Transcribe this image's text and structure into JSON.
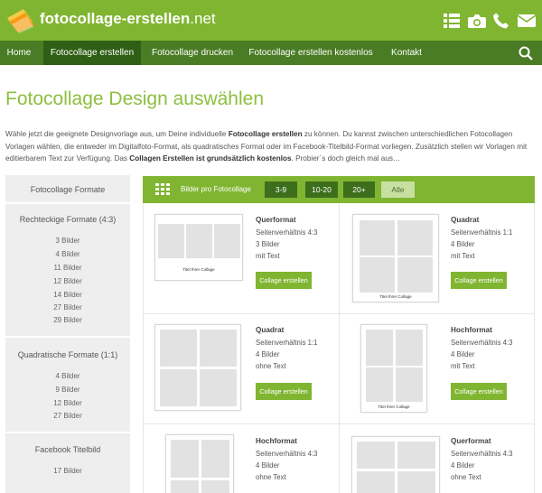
{
  "header": {
    "logo_text_main": "fotocollage-erstellen",
    "logo_text_suffix": ".net",
    "icons": [
      "grid-icon",
      "camera-icon",
      "phone-icon",
      "mail-icon"
    ]
  },
  "nav": {
    "items": [
      {
        "label": "Home",
        "active": false
      },
      {
        "label": "Fotocollage erstellen",
        "active": true
      },
      {
        "label": "Fotocollage drucken",
        "active": false
      },
      {
        "label": "Fotocollage erstellen kostenlos",
        "active": false
      },
      {
        "label": "Kontakt",
        "active": false
      }
    ],
    "search_icon": "search-icon"
  },
  "page": {
    "title": "Fotocollage Design auswählen",
    "intro_1": "Wähle jetzt die geeignete Designvorlage aus, um Deine individuelle ",
    "intro_b1": "Fotocollage erstellen",
    "intro_2": " zu können. Du kannst zwischen unterschiedlichen Fotocollagen Vorlagen wählen, die entweder im Digitalfoto-Format, als quadratisches Format oder im Facebook-Titelbild-Format vorliegen. Zusätzlich stellen wir Vorlagen mit editierbarem Text zur Verfügung. Das ",
    "intro_b2": "Collagen Erstellen ist grundsätzlich kostenlos",
    "intro_3": ". Probier´s doch gleich mal aus…"
  },
  "sidebar": {
    "heading": "Fotocollage Formate",
    "groups": [
      {
        "label": "Rechteckige Formate (4:3)",
        "items": [
          "3 Bilder",
          "4 Bilder",
          "11 Bilder",
          "12 Bilder",
          "14 Bilder",
          "27 Bilder",
          "29 Bilder"
        ]
      },
      {
        "label": "Quadratische Formate (1:1)",
        "items": [
          "4 Bilder",
          "9 Bilder",
          "12 Bilder",
          "27 Bilder"
        ]
      },
      {
        "label": "Facebook Titelbild",
        "items": [
          "17 Bilder"
        ]
      }
    ]
  },
  "filter": {
    "label": "Bilder pro Fotocollage",
    "buttons": [
      "3-9",
      "10-20",
      "20+",
      "Alle"
    ],
    "selected": "Alle"
  },
  "cards": [
    {
      "title": "Querformat",
      "ratio": "Seitenverhältnis 4:3",
      "count": "3 Bilder",
      "text": "mit Text",
      "button": "Collage erstellen",
      "caption": "Titel Ihrer Collage"
    },
    {
      "title": "Quadrat",
      "ratio": "Seitenverhältnis 1:1",
      "count": "4 Bilder",
      "text": "mit Text",
      "button": "Collage erstellen",
      "caption": "Titel Ihrer Collage"
    },
    {
      "title": "Quadrat",
      "ratio": "Seitenverhältnis 1:1",
      "count": "4 Bilder",
      "text": "ohne Text",
      "button": "Collage erstellen",
      "caption": ""
    },
    {
      "title": "Hochformat",
      "ratio": "Seitenverhältnis 4:3",
      "count": "4 Bilder",
      "text": "mit Text",
      "button": "Collage erstellen",
      "caption": "Titel Ihrer Collage"
    },
    {
      "title": "Hochformat",
      "ratio": "Seitenverhältnis 4:3",
      "count": "4 Bilder",
      "text": "ohne Text",
      "button": "",
      "caption": ""
    },
    {
      "title": "Querformat",
      "ratio": "Seitenverhältnis 4:3",
      "count": "4 Bilder",
      "text": "ohne Text",
      "button": "",
      "caption": ""
    }
  ],
  "colors": {
    "brand_green": "#80b532",
    "nav_dark": "#4a7c25",
    "nav_active": "#2f5f14",
    "title_green": "#8cbf3f",
    "filter_button": "#3d6e1c",
    "filter_selected": "#c7e0a1"
  }
}
